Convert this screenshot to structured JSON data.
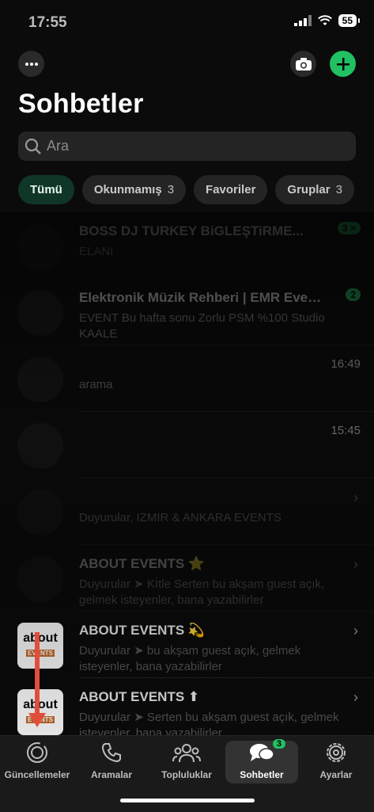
{
  "status": {
    "time": "17:55",
    "battery": "55"
  },
  "header": {
    "title": "Sohbetler"
  },
  "search": {
    "placeholder": "Ara"
  },
  "filters": [
    {
      "label": "Tümü",
      "count": ""
    },
    {
      "label": "Okunmamış",
      "count": "3"
    },
    {
      "label": "Favoriler",
      "count": ""
    },
    {
      "label": "Gruplar",
      "count": "3"
    }
  ],
  "chats": [
    {
      "name": "BOSS DJ TURKEY BiGLEŞTiRME...",
      "time": "",
      "badge": "3 >",
      "message": "ELANI"
    },
    {
      "name": "Elektronik Müzik Rehberi | EMR Event...",
      "time": "",
      "badge": "2",
      "message": "EVENT Bu hafta sonu Zorlu PSM %100 Studio KAALE"
    },
    {
      "name": "",
      "time": "16:49",
      "badge": "",
      "message": "arama"
    },
    {
      "name": "",
      "time": "15:45",
      "badge": "",
      "message": ""
    },
    {
      "name": "",
      "time": "",
      "badge": "",
      "message": "Duyurular, IZMIR & ANKARA EVENTS"
    },
    {
      "name": "ABOUT EVENTS ⭐",
      "time": "",
      "badge": "",
      "message": "Duyurular ➤ Kİtle Serten bu akşam guest açık, gelmek isteyenler, bana yazabilirler"
    },
    {
      "name": "ABOUT EVENTS 💫",
      "time": "",
      "badge": "",
      "message": "Duyurular ➤ bu akşam guest açık, gelmek isteyenler, bana yazabilirler"
    },
    {
      "name": "ABOUT EVENTS ⬆",
      "time": "",
      "badge": "",
      "message": "Duyurular ➤ Serten bu akşam guest açık, gelmek isteyenler, bana yazabilirler"
    }
  ],
  "logo": {
    "top": "about",
    "bottom": "EVENTS"
  },
  "tabs": [
    {
      "label": "Güncellemeler",
      "icon": "updates-icon"
    },
    {
      "label": "Aramalar",
      "icon": "phone-icon"
    },
    {
      "label": "Topluluklar",
      "icon": "communities-icon"
    },
    {
      "label": "Sohbetler",
      "icon": "chats-icon",
      "badge": "3"
    },
    {
      "label": "Ayarlar",
      "icon": "settings-icon"
    }
  ],
  "colors": {
    "accent": "#21c063",
    "active_chip": "#103628",
    "arrow": "#e24d3b"
  }
}
